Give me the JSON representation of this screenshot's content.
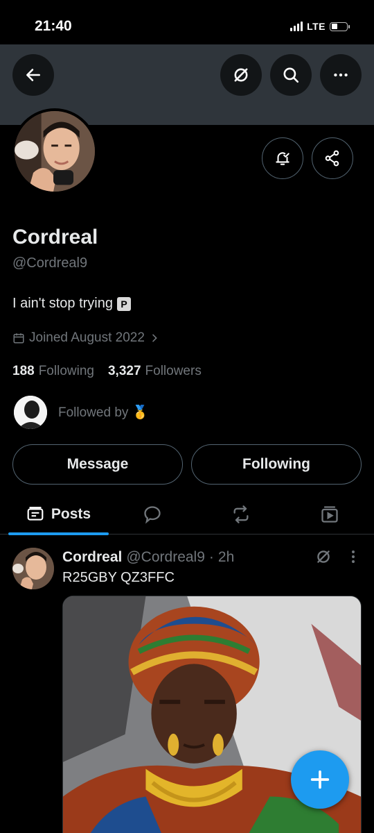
{
  "status_bar": {
    "time": "21:40",
    "network": "LTE"
  },
  "header": {
    "back_icon": "arrow-left-icon",
    "grok_icon": "grok-icon",
    "search_icon": "search-icon",
    "more_icon": "more-horizontal-icon"
  },
  "profile": {
    "name": "Cordreal",
    "handle": "@Cordreal9",
    "bio_text": "I ain't stop trying",
    "bio_badge": "P",
    "joined": "Joined August 2022",
    "following_count": "188",
    "following_label": "Following",
    "followers_count": "3,327",
    "followers_label": "Followers",
    "followed_by_label": "Followed by",
    "followed_by_emoji": "🥇"
  },
  "actions": {
    "message_label": "Message",
    "following_label": "Following"
  },
  "tabs": [
    {
      "label": "Posts",
      "icon": "posts-icon"
    },
    {
      "label": "",
      "icon": "replies-icon"
    },
    {
      "label": "",
      "icon": "reposts-icon"
    },
    {
      "label": "",
      "icon": "media-icon"
    }
  ],
  "post": {
    "name": "Cordreal",
    "handle": "@Cordreal9",
    "separator": "·",
    "time": "2h",
    "text": "R25GBY QZ3FFC"
  },
  "colors": {
    "accent": "#1d9bf0",
    "muted": "#71767b",
    "border": "#536471",
    "banner": "#2f353b"
  }
}
